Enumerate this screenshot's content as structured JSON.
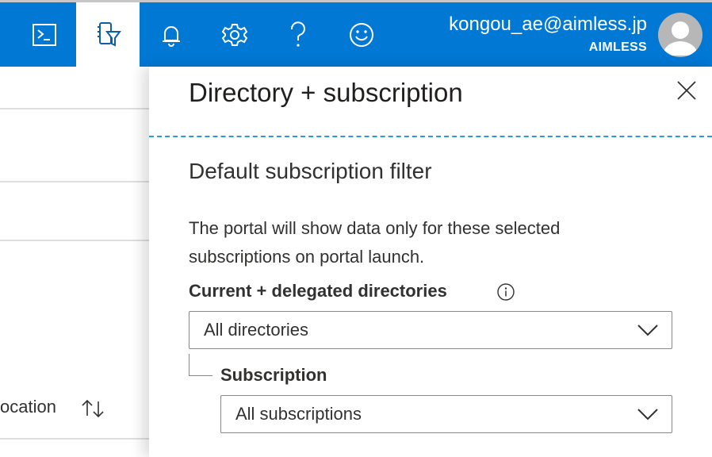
{
  "topbar": {
    "icons": [
      "cloud-shell-icon",
      "directory-filter-icon",
      "bell-icon",
      "gear-icon",
      "help-icon",
      "feedback-icon"
    ],
    "user_email": "kongou_ae@aimless.jp",
    "user_tenant": "AIMLESS",
    "accent": "#0078d4"
  },
  "background_list": {
    "column_label": "ocation"
  },
  "panel": {
    "title": "Directory + subscription",
    "section_title": "Default subscription filter",
    "description": "The portal will show data only for these selected subscriptions on portal launch.",
    "directories_label": "Current + delegated directories",
    "directories_value": "All directories",
    "subscription_label": "Subscription",
    "subscription_value": "All subscriptions",
    "divider_color": "#2b9ad6"
  }
}
